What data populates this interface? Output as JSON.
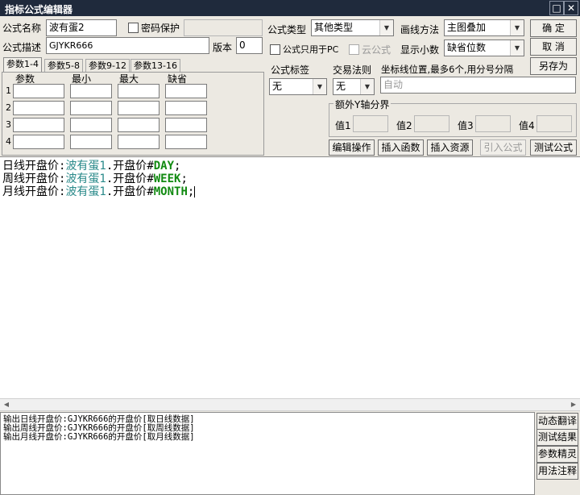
{
  "window": {
    "title": "指标公式编辑器",
    "min_glyph": "□",
    "close_glyph": "✕"
  },
  "form": {
    "name_label": "公式名称",
    "name_value": "波有蛋2",
    "password_label": "密码保护",
    "desc_label": "公式描述",
    "desc_value": "GJYKR666",
    "version_label": "版本",
    "version_value": "0",
    "type_label": "公式类型",
    "type_value": "其他类型",
    "draw_label": "画线方法",
    "draw_value": "主图叠加",
    "pc_only_label": "公式只用于PC",
    "cloud_label": "云公式",
    "decimals_label": "显示小数",
    "decimals_value": "缺省位数"
  },
  "buttons": {
    "ok": "确  定",
    "cancel": "取  消",
    "save_as": "另存为",
    "edit_ops": "编辑操作",
    "insert_func": "插入函数",
    "insert_res": "插入资源",
    "import_formula": "引入公式",
    "test_formula": "测试公式"
  },
  "tabs": [
    "参数1-4",
    "参数5-8",
    "参数9-12",
    "参数13-16"
  ],
  "params": {
    "headers": [
      "参数",
      "最小",
      "最大",
      "缺省"
    ],
    "rows": [
      "1",
      "2",
      "3",
      "4"
    ]
  },
  "tags": {
    "formula_tag_label": "公式标签",
    "formula_tag_value": "无",
    "trade_rule_label": "交易法则",
    "trade_rule_value": "无",
    "coord_label": "坐标线位置,最多6个,用分号分隔",
    "coord_value": "自动"
  },
  "yaxis": {
    "title": "额外Y轴分界",
    "v1": "值1",
    "v2": "值2",
    "v3": "值3",
    "v4": "值4"
  },
  "code": [
    {
      "label": "日线开盘价",
      "sep": ":",
      "id": "波有蛋1",
      "rest": ".开盘价",
      "hash": "#",
      "kw": "DAY",
      "end": ";"
    },
    {
      "label": "周线开盘价",
      "sep": ":",
      "id": "波有蛋1",
      "rest": ".开盘价",
      "hash": "#",
      "kw": "WEEK",
      "end": ";"
    },
    {
      "label": "月线开盘价",
      "sep": ":",
      "id": "波有蛋1",
      "rest": ".开盘价",
      "hash": "#",
      "kw": "MONTH",
      "end": ";"
    }
  ],
  "output_lines": [
    "输出日线开盘价:GJYKR666的开盘价[取日线数据]",
    "输出周线开盘价:GJYKR666的开盘价[取周线数据]",
    "输出月线开盘价:GJYKR666的开盘价[取月线数据]"
  ],
  "side_buttons": {
    "translate": "动态翻译",
    "test_result": "测试结果",
    "param_wizard": "参数精灵",
    "usage": "用法注释"
  }
}
